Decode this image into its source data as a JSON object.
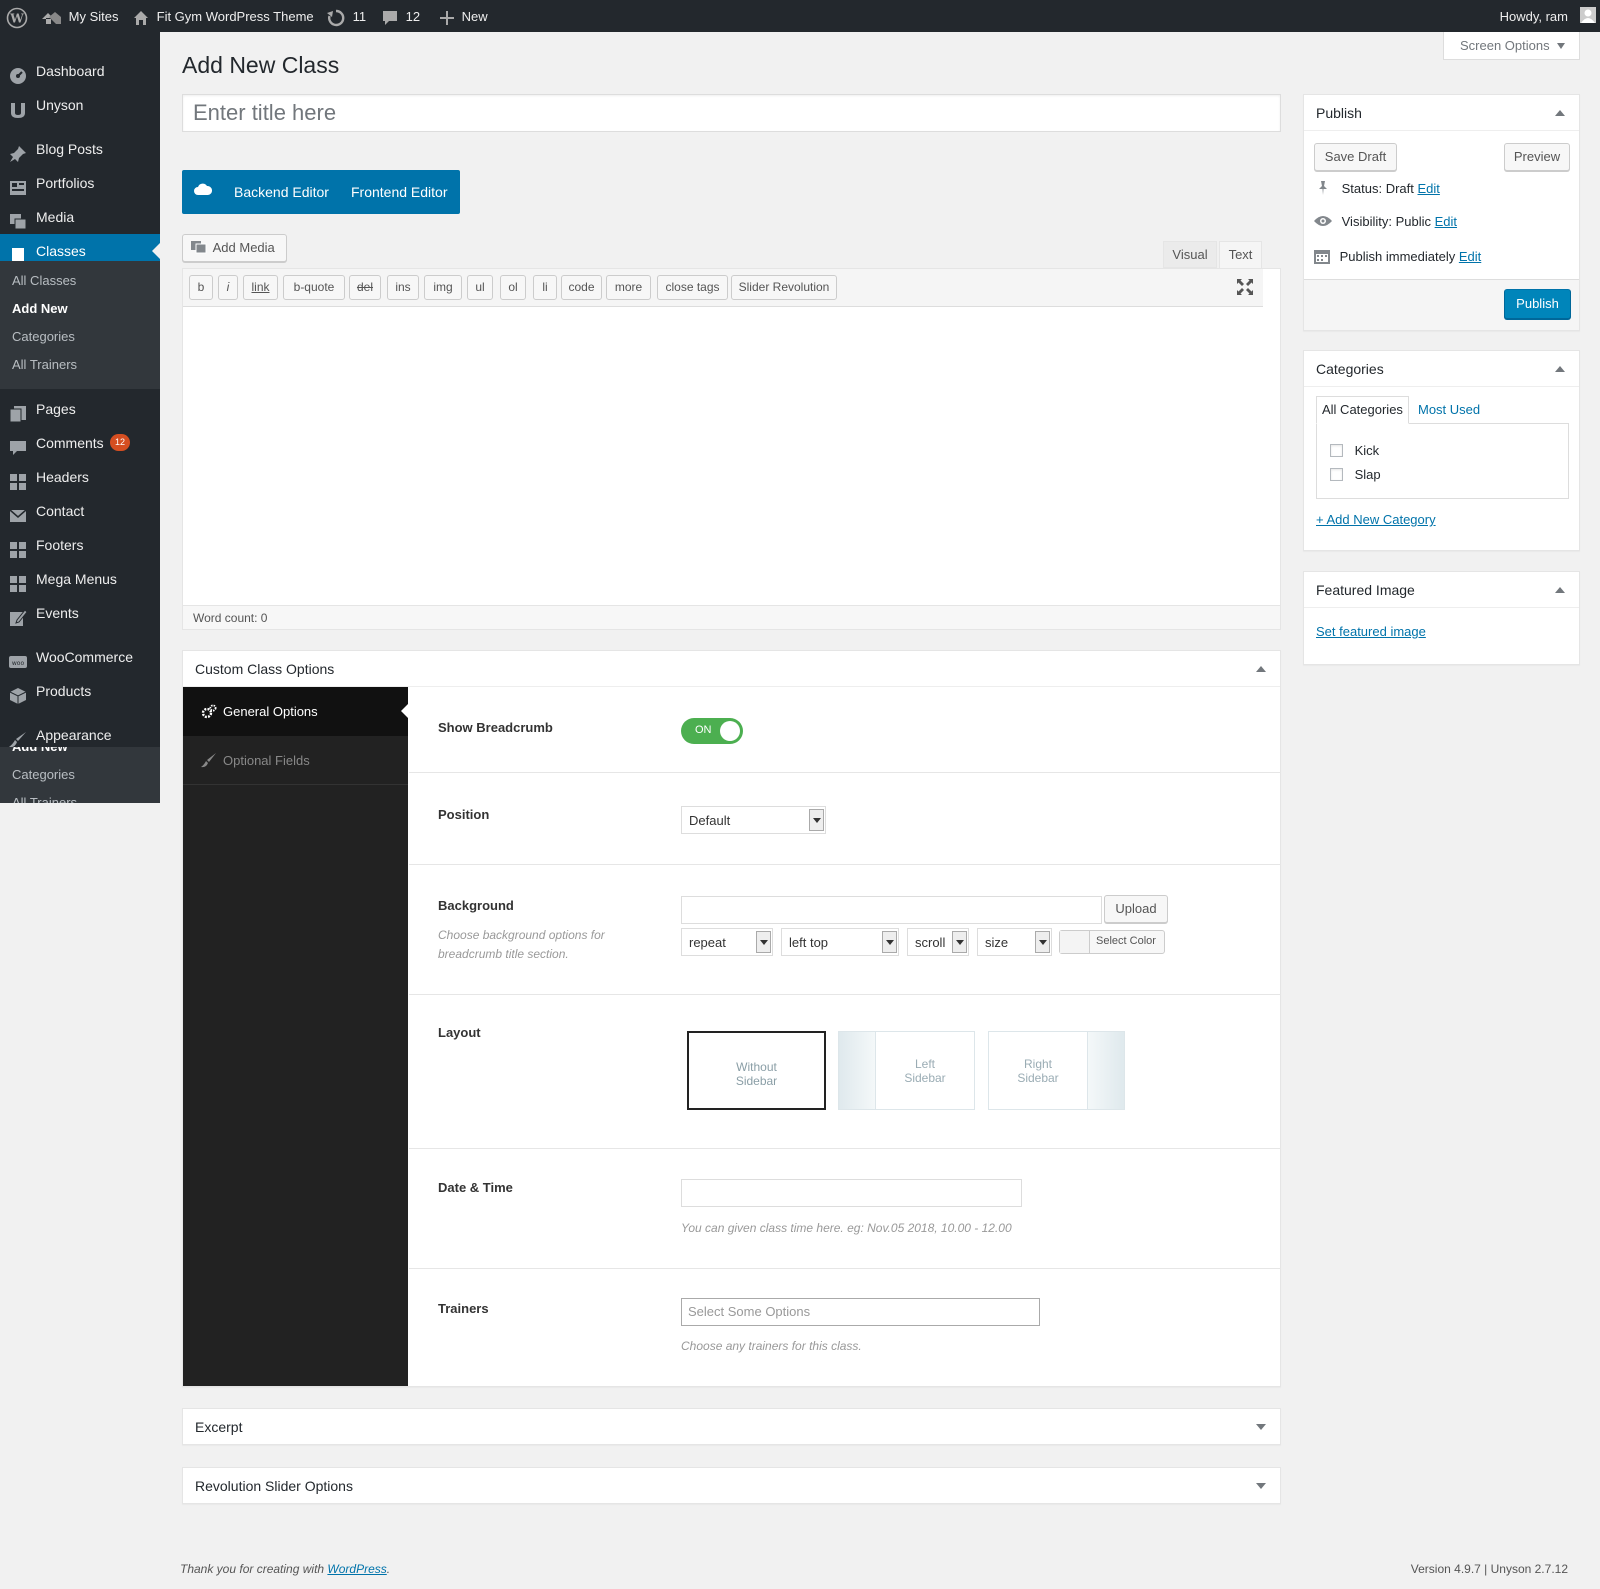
{
  "adminbar": {
    "my_sites": "My Sites",
    "site_name": "Fit Gym WordPress Theme",
    "updates_count": "11",
    "comments_count": "12",
    "new_label": "New",
    "howdy": "Howdy, ram"
  },
  "screen_options": "Screen Options",
  "sidebar": {
    "items": [
      {
        "label": "Dashboard",
        "icon": "dashboard-icon"
      },
      {
        "label": "Unyson",
        "icon": "unyson-icon"
      },
      {
        "label": "Blog Posts",
        "icon": "pin-icon"
      },
      {
        "label": "Portfolios",
        "icon": "portfolio-icon"
      },
      {
        "label": "Media",
        "icon": "media-icon"
      },
      {
        "label": "Classes",
        "icon": "book-icon"
      },
      {
        "label": "Pages",
        "icon": "pages-icon"
      },
      {
        "label": "Comments",
        "icon": "comment-icon",
        "badge": "12"
      },
      {
        "label": "Headers",
        "icon": "grid-icon"
      },
      {
        "label": "Contact",
        "icon": "mail-icon"
      },
      {
        "label": "Footers",
        "icon": "grid-icon"
      },
      {
        "label": "Mega Menus",
        "icon": "grid-icon"
      },
      {
        "label": "Events",
        "icon": "edit-icon"
      },
      {
        "label": "WooCommerce",
        "icon": "woo-icon"
      },
      {
        "label": "Products",
        "icon": "products-icon"
      },
      {
        "label": "Appearance",
        "icon": "brush-icon"
      }
    ],
    "submenu": [
      "All Classes",
      "Add New",
      "Categories",
      "All Trainers"
    ],
    "overflow_submenu": [
      "Add New",
      "Categories",
      "All Trainers"
    ]
  },
  "page": {
    "title": "Add New Class",
    "title_placeholder": "Enter title here"
  },
  "builder": {
    "backend": "Backend Editor",
    "frontend": "Frontend Editor"
  },
  "editor": {
    "add_media": "Add Media",
    "tab_visual": "Visual",
    "tab_text": "Text",
    "quicktags": [
      "b",
      "i",
      "link",
      "b-quote",
      "del",
      "ins",
      "img",
      "ul",
      "ol",
      "li",
      "code",
      "more",
      "close tags",
      "Slider Revolution"
    ],
    "word_count": "Word count: 0"
  },
  "publish": {
    "title": "Publish",
    "save_draft": "Save Draft",
    "preview": "Preview",
    "status_label": "Status: ",
    "status_value": "Draft",
    "visibility_label": "Visibility: ",
    "visibility_value": "Public",
    "publish_label": "Publish ",
    "publish_value": "immediately",
    "edit": "Edit",
    "publish_button": "Publish"
  },
  "categories": {
    "title": "Categories",
    "tab_all": "All Categories",
    "tab_most_used": "Most Used",
    "items": [
      "Kick",
      "Slap"
    ],
    "add_new": "+ Add New Category"
  },
  "featured": {
    "title": "Featured Image",
    "set": "Set featured image"
  },
  "custom_options": {
    "title": "Custom Class Options",
    "tabs": [
      "General Options",
      "Optional Fields"
    ],
    "show_breadcrumb": "Show Breadcrumb",
    "toggle": "ON",
    "position": "Position",
    "position_value": "Default",
    "background": "Background",
    "background_desc": "Choose background options for breadcrumb title section.",
    "upload": "Upload",
    "bg_repeat": "repeat",
    "bg_position": "left top",
    "bg_attachment": "scroll",
    "bg_size": "size",
    "select_color": "Select Color",
    "layout": "Layout",
    "layouts": [
      "Without Sidebar",
      "Left Sidebar",
      "Right Sidebar"
    ],
    "date_time": "Date & Time",
    "date_desc": "You can given class time here. eg: Nov.05 2018, 10.00 - 12.00",
    "trainers": "Trainers",
    "trainers_placeholder": "Select Some Options",
    "trainers_desc": "Choose any trainers for this class."
  },
  "excerpt": "Excerpt",
  "revslider": "Revolution Slider Options",
  "footer": {
    "thanks": "Thank you for creating with ",
    "wp": "WordPress",
    "version": "Version 4.9.7 | Unyson 2.7.12"
  },
  "colors": {
    "adminbar": "#23282d",
    "accent": "#0073aa",
    "toggle_on": "#4caf50",
    "options_tabs_bg": "#222222"
  }
}
